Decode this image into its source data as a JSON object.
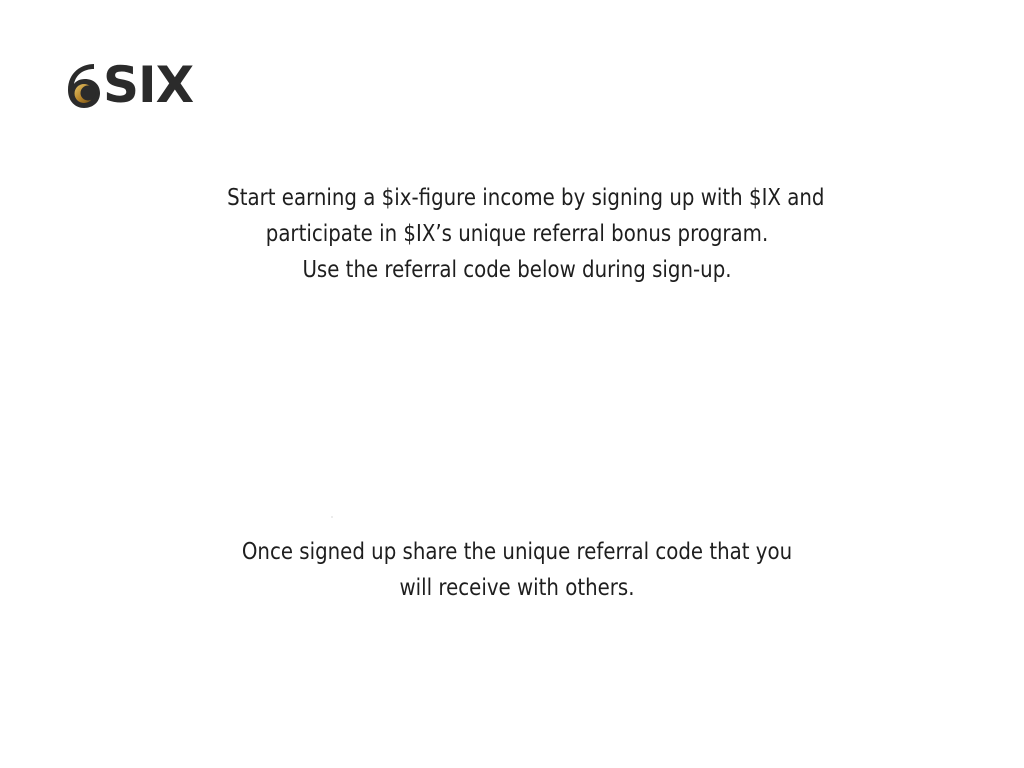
{
  "logo": {
    "text": "SIX",
    "icon": "six-logo-icon",
    "colors": {
      "text": "#2b2b2b",
      "ring": "#2b2b2b",
      "accent": "#b8862b"
    }
  },
  "intro": {
    "line1": "Start earning a $ix-figure income by signing up with $IX and",
    "line2": "participate in $IX’s unique referral bonus program.",
    "line3": "Use the referral code below during sign-up."
  },
  "note": {
    "line1": "Once signed up share the unique referral code that you",
    "line2": "will receive with others."
  }
}
